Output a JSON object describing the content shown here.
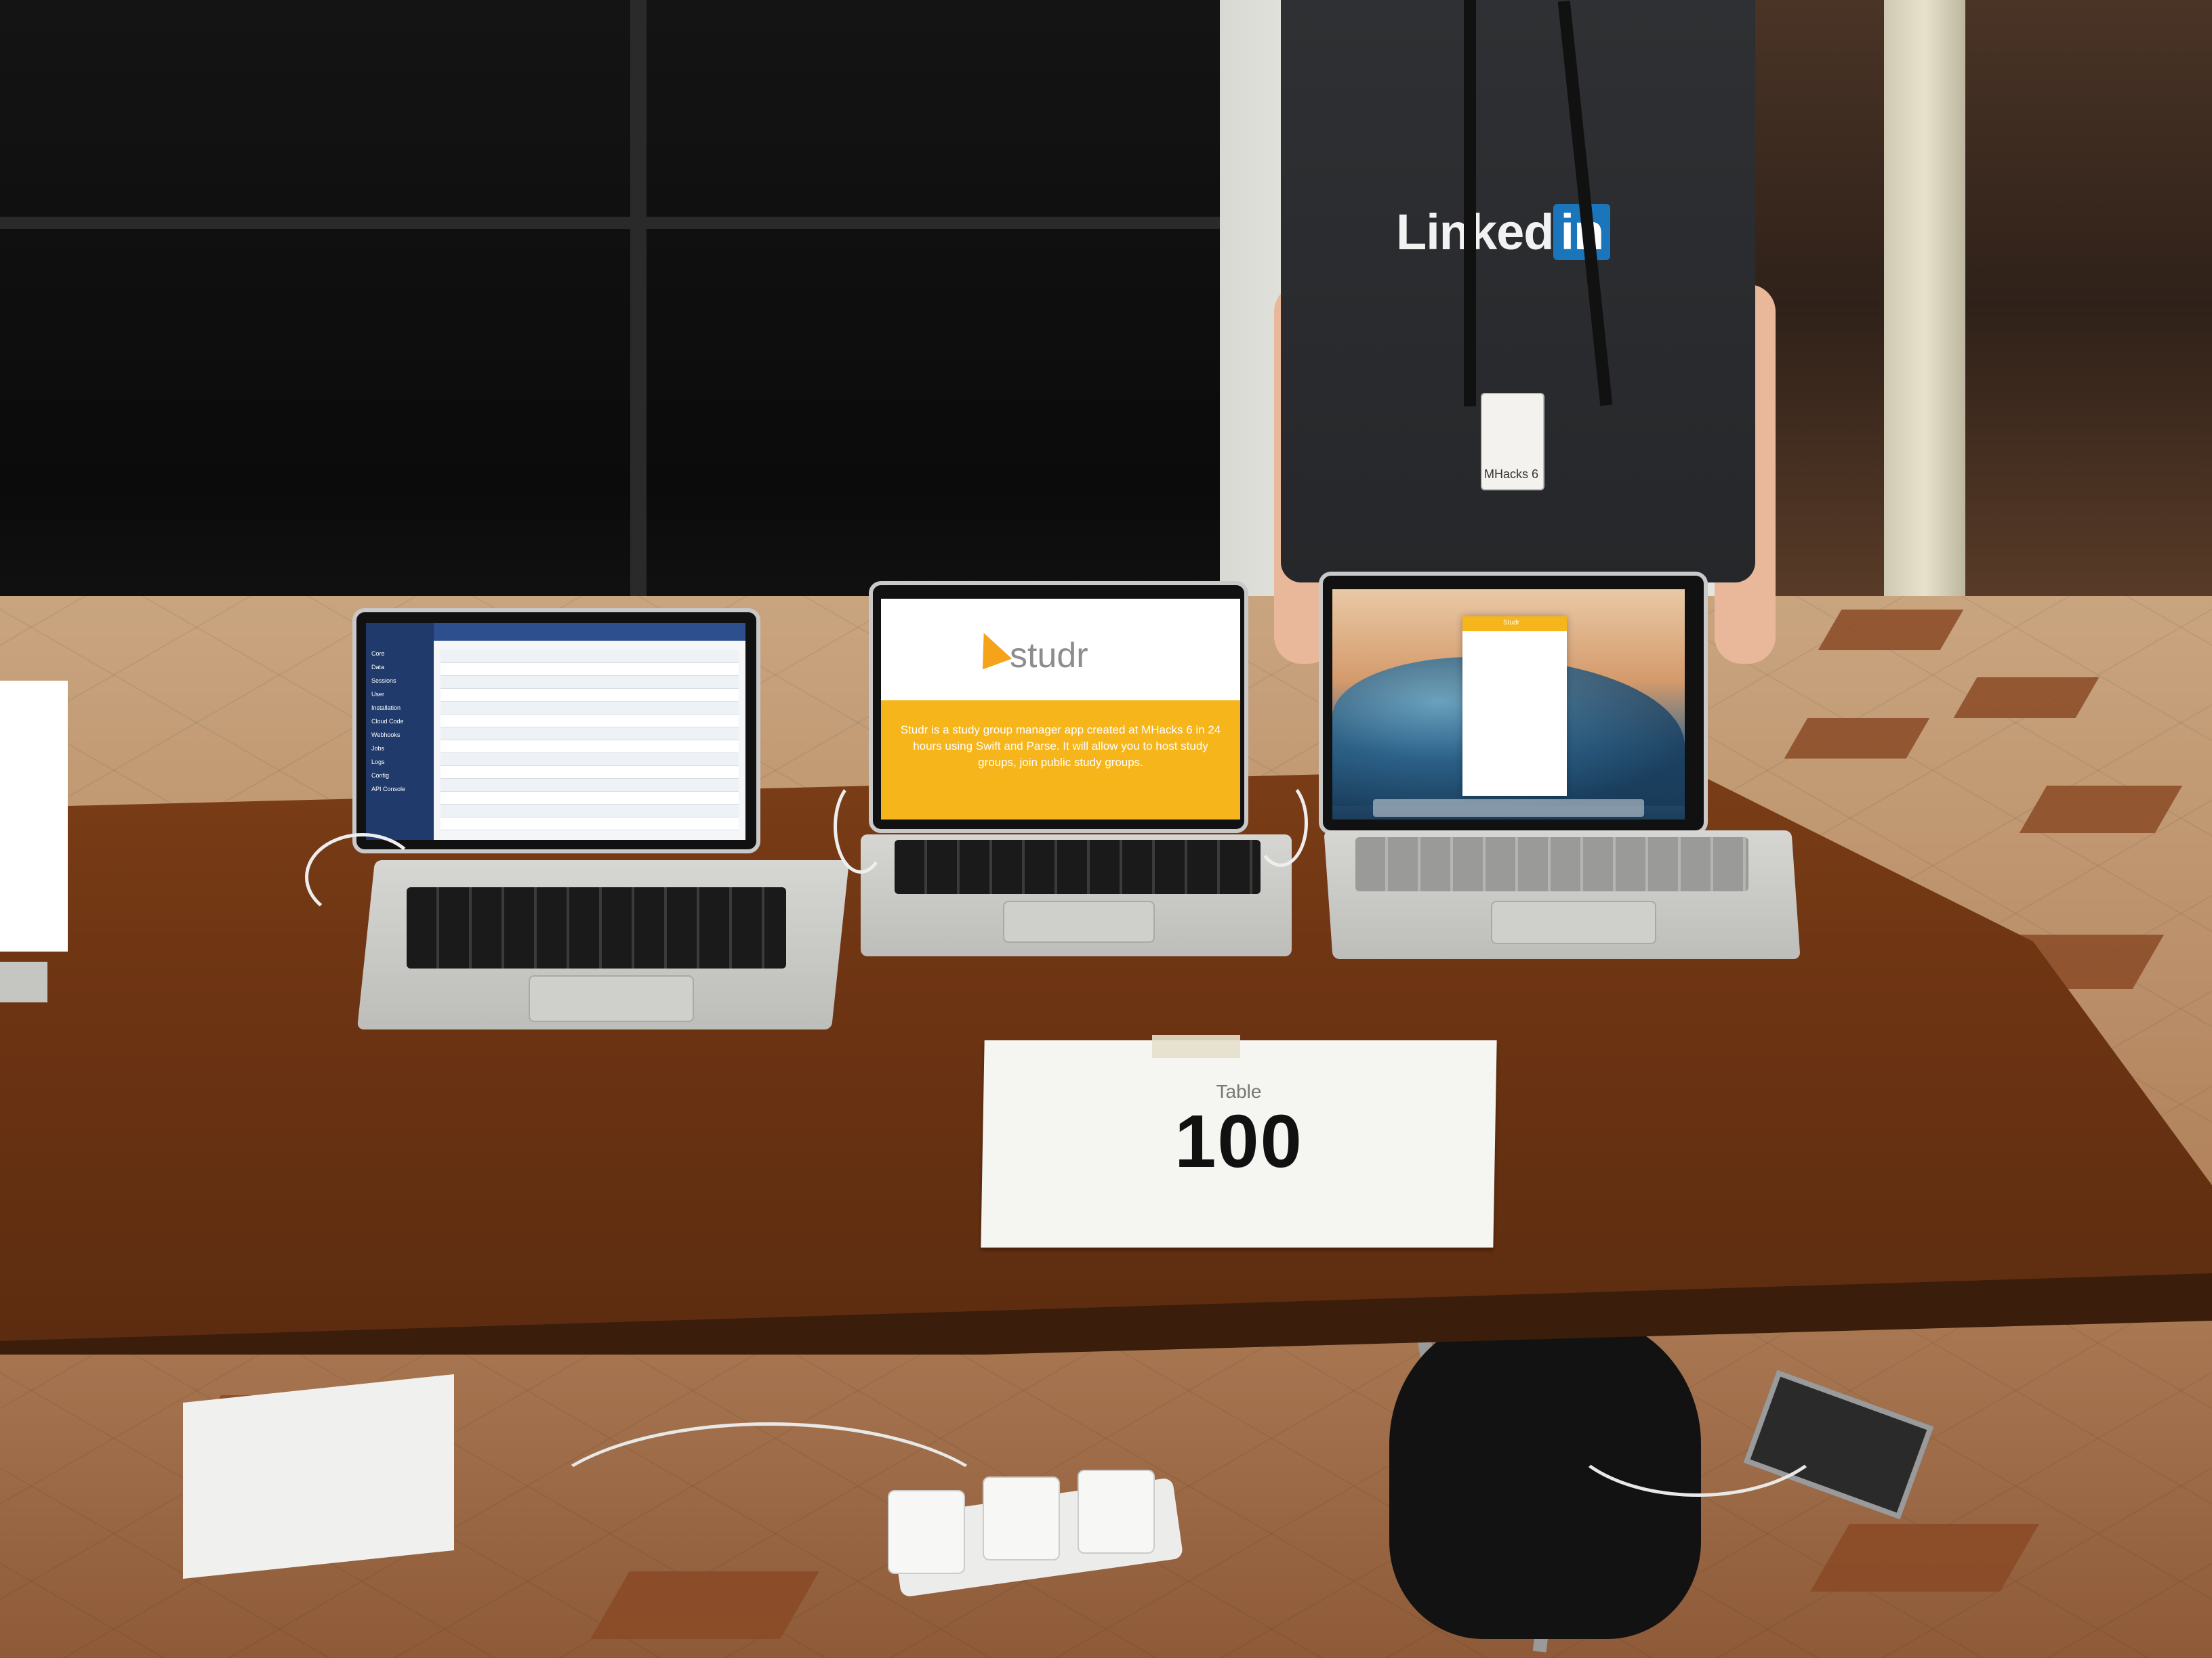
{
  "scene": {
    "shirt_brand": "Linked",
    "shirt_brand_in": "in",
    "badge_text": "MHacks 6"
  },
  "laptops": {
    "left_app": {
      "sidebar_items": [
        "Core",
        "Data",
        "Sessions",
        "User",
        "Installation",
        "Cloud Code",
        "Webhooks",
        "Jobs",
        "Logs",
        "Config",
        "API Console"
      ]
    },
    "middle_app": {
      "logo": "studr",
      "description": "Studr is a study group manager app created at MHacks 6 in 24 hours using Swift and Parse. It will allow you to host study groups, join public study groups."
    },
    "right_app": {
      "window_title": "Studr"
    }
  },
  "sign": {
    "label": "Table",
    "number": "100"
  }
}
